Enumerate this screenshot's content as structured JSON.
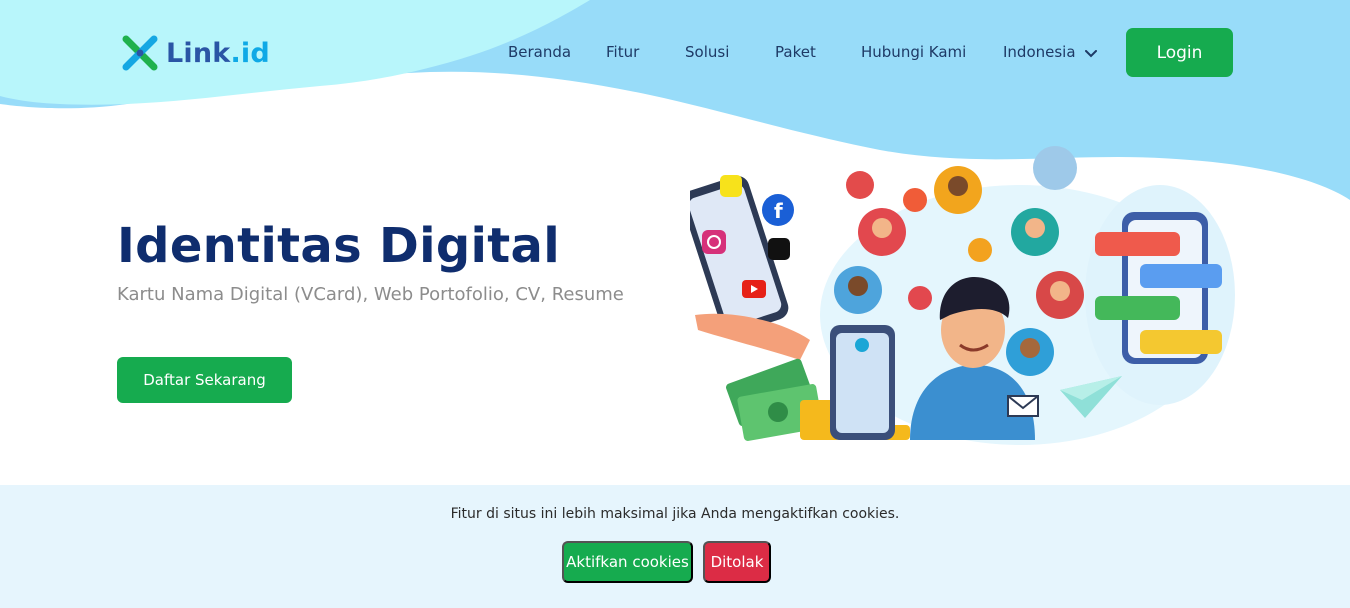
{
  "brand": {
    "name_main": "Link",
    "name_suffix": ".id"
  },
  "nav": {
    "items": [
      {
        "label": "Beranda"
      },
      {
        "label": "Fitur"
      },
      {
        "label": "Solusi"
      },
      {
        "label": "Paket"
      },
      {
        "label": "Hubungi Kami"
      }
    ],
    "language": "Indonesia",
    "login_label": "Login"
  },
  "hero": {
    "title": "Identitas Digital",
    "subtitle": "Kartu Nama Digital (VCard), Web Portofolio, CV, Resume",
    "cta_label": "Daftar Sekarang"
  },
  "illustration": {
    "icons": [
      "snapchat-icon",
      "instagram-icon",
      "facebook-icon",
      "tiktok-icon",
      "youtube-icon",
      "chat-bubbles",
      "paper-plane-icon",
      "money-icon",
      "coins-icon",
      "avatar-icons"
    ]
  },
  "cookie": {
    "message": "Fitur di situs ini lebih maksimal jika Anda mengaktifkan cookies.",
    "accept_label": "Aktifkan cookies",
    "decline_label": "Ditolak"
  },
  "colors": {
    "primary_green": "#16ab4f",
    "danger_red": "#dc2c45",
    "title_navy": "#0f2d6e",
    "wave_blue": "#98dcf9",
    "wave_cyan": "#b8f6fb",
    "cookie_bg": "#e6f5fd"
  }
}
